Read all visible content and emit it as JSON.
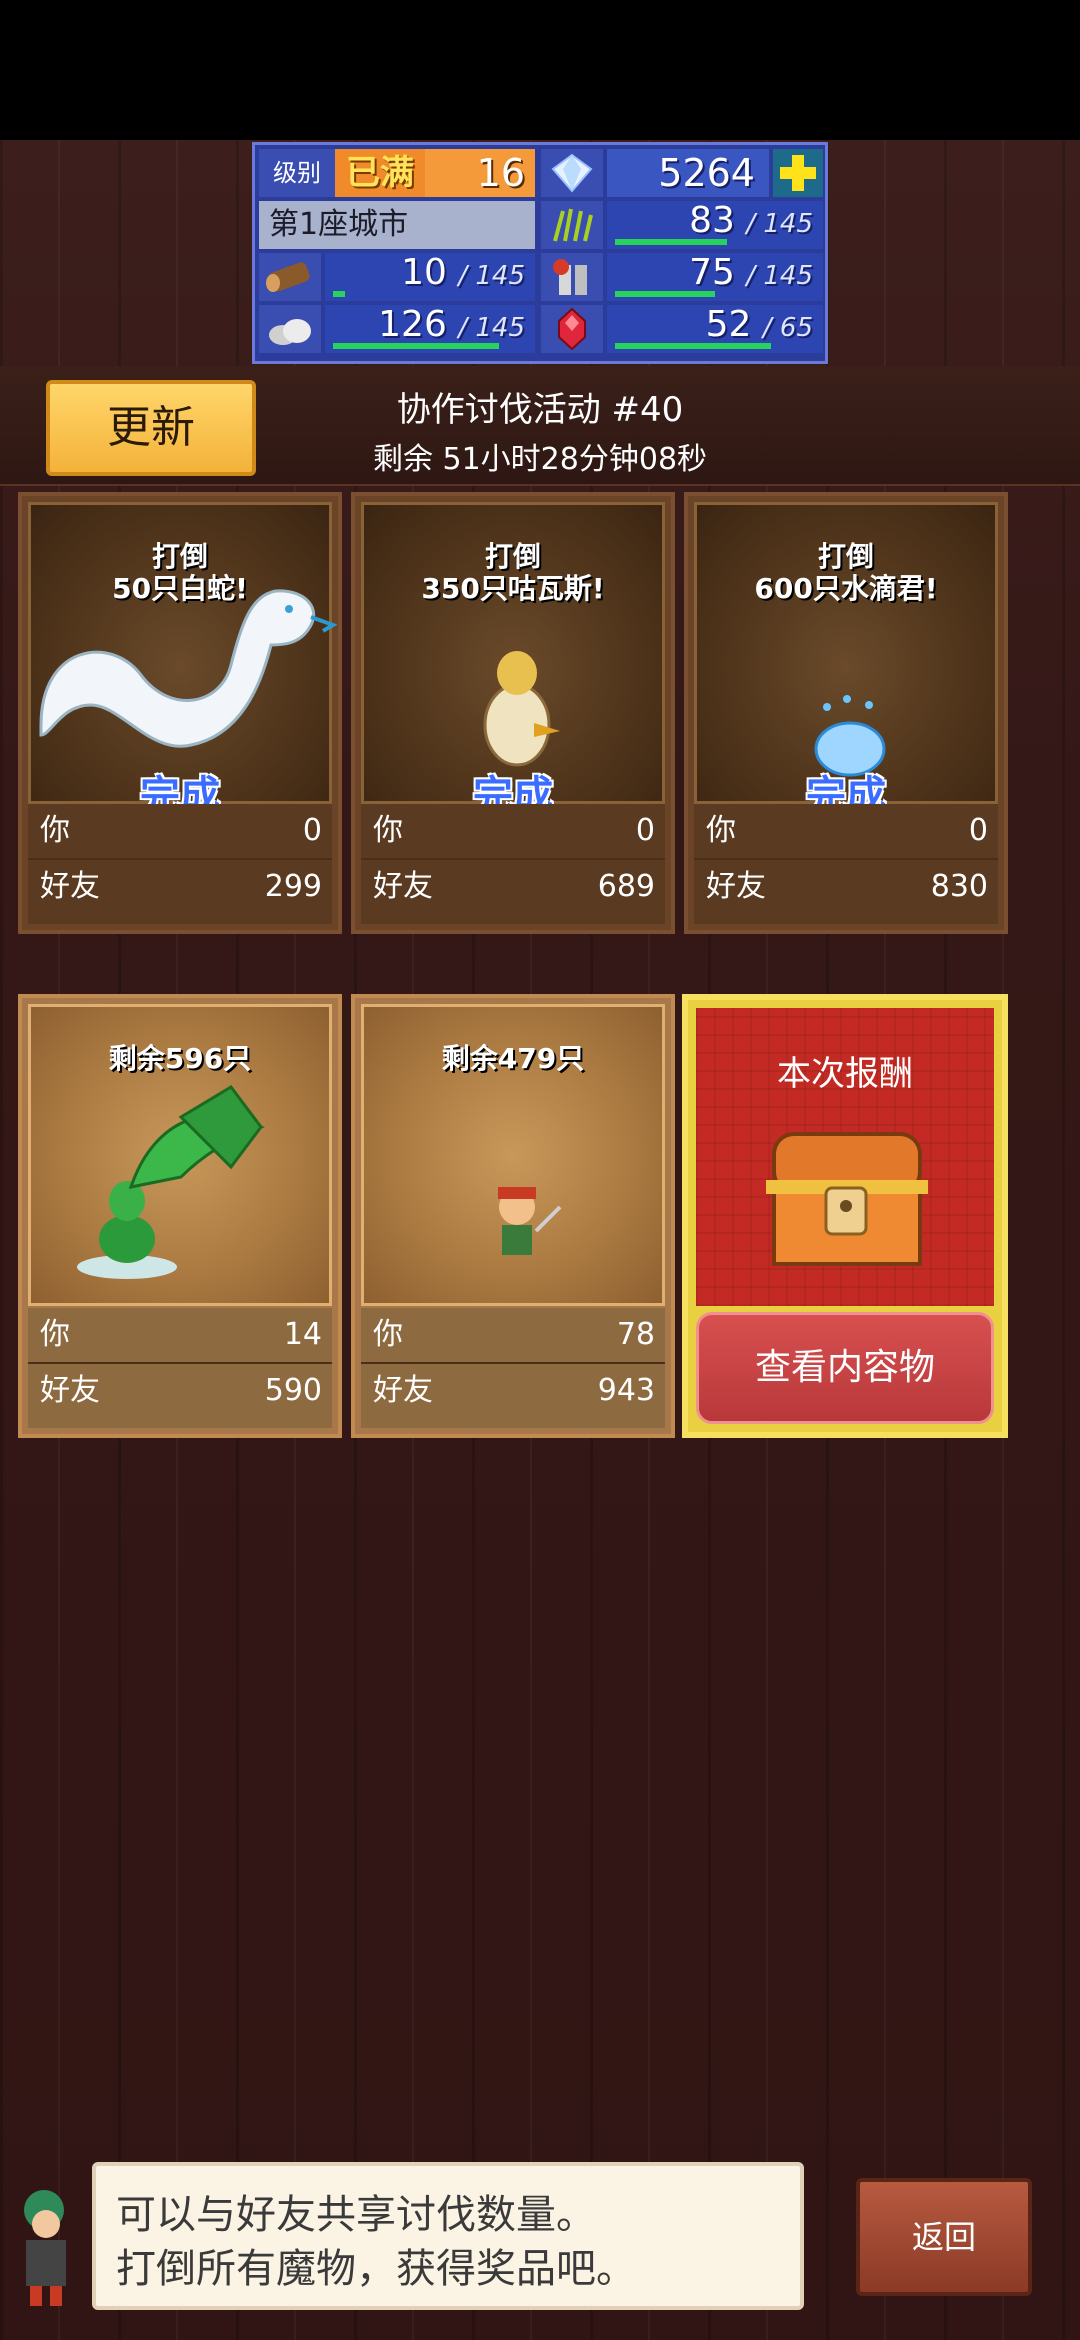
{
  "status": {
    "level_label": "级别",
    "level_max": "已满",
    "level": "16",
    "gems": "5264",
    "city": "第1座城市",
    "resources": [
      {
        "icon": "grass-icon",
        "value": "83",
        "max": "145",
        "fill": 0.57
      },
      {
        "icon": "wood-log-icon",
        "value": "10",
        "max": "145",
        "fill": 0.07
      },
      {
        "icon": "tools-icon",
        "value": "75",
        "max": "145",
        "fill": 0.52
      },
      {
        "icon": "stone-icon",
        "value": "126",
        "max": "145",
        "fill": 0.87
      },
      {
        "icon": "red-gem-icon",
        "value": "52",
        "max": "65",
        "fill": 0.8
      }
    ]
  },
  "header": {
    "update_label": "更新",
    "title": "协作讨伐活动 #40",
    "remaining": "剩余 51小时28分钟08秒"
  },
  "cards": [
    {
      "goal": "打倒\n50只白蛇!",
      "done": "完成",
      "you_label": "你",
      "you": "0",
      "friend_label": "好友",
      "friend": "299",
      "monster": "white-snake-icon"
    },
    {
      "goal": "打倒\n350只咕瓦斯!",
      "done": "完成",
      "you_label": "你",
      "you": "0",
      "friend_label": "好友",
      "friend": "689",
      "monster": "bird-monster-icon"
    },
    {
      "goal": "打倒\n600只水滴君!",
      "done": "完成",
      "you_label": "你",
      "you": "0",
      "friend_label": "好友",
      "friend": "830",
      "monster": "water-drop-icon"
    },
    {
      "goal": "剩余596只",
      "you_label": "你",
      "you": "14",
      "friend_label": "好友",
      "friend": "590",
      "monster": "plant-monster-icon"
    },
    {
      "goal": "剩余479只",
      "you_label": "你",
      "you": "78",
      "friend_label": "好友",
      "friend": "943",
      "monster": "pirate-icon"
    }
  ],
  "reward": {
    "title": "本次报酬",
    "view_label": "查看内容物"
  },
  "dialog": {
    "line1": "可以与好友共享讨伐数量。",
    "line2": "打倒所有魔物，获得奖品吧。"
  },
  "back_label": "返回"
}
